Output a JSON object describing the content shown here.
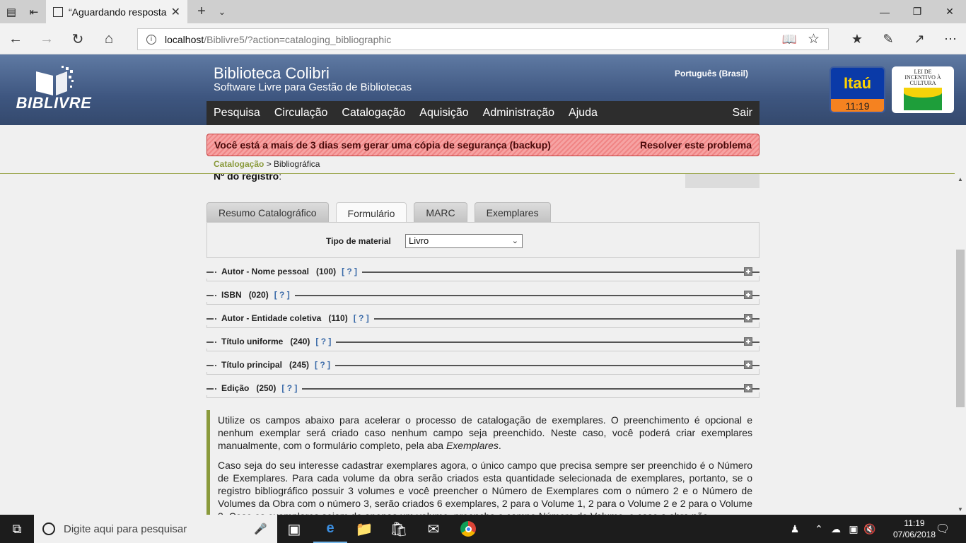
{
  "browser": {
    "tab_title": "“Aguardando resposta d",
    "url_host": "localhost",
    "url_rest": "/Biblivre5/?action=cataloging_bibliographic"
  },
  "header": {
    "logo_text": "BIBLIVRE",
    "site_title": "Biblioteca Colibri",
    "site_subtitle": "Software Livre para Gestão de Bibliotecas",
    "language": "Português (Brasil)",
    "sponsor_itau": "Itaú",
    "sponsor_time": "11:19",
    "lei_text": "LEI DE INCENTIVO À CULTURA",
    "menu": [
      "Pesquisa",
      "Circulação",
      "Catalogação",
      "Aquisição",
      "Administração",
      "Ajuda"
    ],
    "logout": "Sair"
  },
  "warning": {
    "message": "Você está a mais de 3 dias sem gerar uma cópia de segurança (backup)",
    "action": "Resolver este problema"
  },
  "breadcrumb": {
    "link": "Catalogação",
    "separator": " > ",
    "current": "Bibliográfica"
  },
  "record": {
    "label": "Nº do registro",
    "suffix": ":"
  },
  "tabs": [
    "Resumo Catalográfico",
    "Formulário",
    "MARC",
    "Exemplares"
  ],
  "material": {
    "label": "Tipo de material",
    "value": "Livro"
  },
  "fields": [
    {
      "label": "Autor - Nome pessoal",
      "code": "(100)",
      "help": "[ ? ]"
    },
    {
      "label": "ISBN",
      "code": "(020)",
      "help": "[ ? ]"
    },
    {
      "label": "Autor - Entidade coletiva",
      "code": "(110)",
      "help": "[ ? ]"
    },
    {
      "label": "Título uniforme",
      "code": "(240)",
      "help": "[ ? ]"
    },
    {
      "label": "Título principal",
      "code": "(245)",
      "help": "[ ? ]"
    },
    {
      "label": "Edição",
      "code": "(250)",
      "help": "[ ? ]"
    }
  ],
  "info": {
    "p1_start": "Utilize os campos abaixo para acelerar o processo de catalogação de exemplares. O preenchimento é opcional e nenhum exemplar será criado caso nenhum campo seja preenchido. Neste caso, você poderá criar exemplares manualmente, com o formulário completo, pela aba ",
    "p1_em": "Exemplares",
    "p1_end": ".",
    "p2": "Caso seja do seu interesse cadastrar exemplares agora, o único campo que precisa sempre ser preenchido é o Número de Exemplares. Para cada volume da obra serão criados esta quantidade selecionada de exemplares, portanto, se o registro bibliográfico possuir 3 volumes e você preencher o Número de Exemplares com o número 2 e o Número de Volumes da Obra com o número 3, serão criados 6 exemplares, 2 para o Volume 1, 2 para o Volume 2 e 2 para o Volume 3. Caso os exemplares sejam de apenas um volume, preencha o campo Número do Volume, e caso a obra não"
  },
  "taskbar": {
    "search_placeholder": "Digite aqui para pesquisar",
    "time": "11:19",
    "date": "07/06/2018"
  },
  "colors": {
    "header_blue": "#3e5680",
    "accent_olive": "#8a9a3c",
    "warning_red": "#f08585",
    "menu_dark": "#2d2d2d"
  }
}
